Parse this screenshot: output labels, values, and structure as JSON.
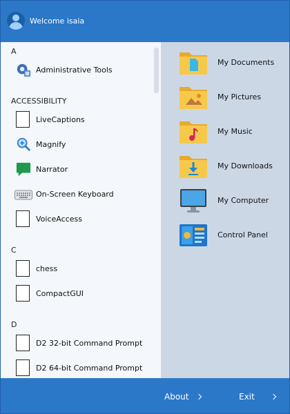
{
  "header": {
    "welcome": "Welcome isaia"
  },
  "apps": {
    "groups": [
      {
        "header": "A",
        "items": [
          {
            "label": "Administrative Tools",
            "icon": "admin-tools-icon"
          }
        ]
      },
      {
        "header": "ACCESSIBILITY",
        "items": [
          {
            "label": "LiveCaptions",
            "icon": "blank-app-icon"
          },
          {
            "label": "Magnify",
            "icon": "magnifier-icon"
          },
          {
            "label": "Narrator",
            "icon": "narrator-icon"
          },
          {
            "label": "On-Screen Keyboard",
            "icon": "keyboard-icon"
          },
          {
            "label": "VoiceAccess",
            "icon": "blank-app-icon"
          }
        ]
      },
      {
        "header": "C",
        "items": [
          {
            "label": "chess",
            "icon": "blank-app-icon"
          },
          {
            "label": "CompactGUI",
            "icon": "blank-app-icon"
          }
        ]
      },
      {
        "header": "D",
        "items": [
          {
            "label": "D2 32-bit Command Prompt",
            "icon": "blank-app-icon"
          },
          {
            "label": "D2 64-bit Command Prompt",
            "icon": "blank-app-icon"
          }
        ]
      }
    ]
  },
  "places": [
    {
      "label": "My Documents",
      "icon": "documents-folder-icon"
    },
    {
      "label": "My Pictures",
      "icon": "pictures-folder-icon"
    },
    {
      "label": "My Music",
      "icon": "music-folder-icon"
    },
    {
      "label": "My Downloads",
      "icon": "downloads-folder-icon"
    },
    {
      "label": "My Computer",
      "icon": "computer-icon"
    },
    {
      "label": "Control Panel",
      "icon": "control-panel-icon"
    }
  ],
  "footer": {
    "about": "About",
    "exit": "Exit"
  },
  "colors": {
    "accent": "#2b78c8",
    "left_bg": "#f4f7fb",
    "right_bg": "#ccd7e6",
    "folder": "#f4c542"
  }
}
